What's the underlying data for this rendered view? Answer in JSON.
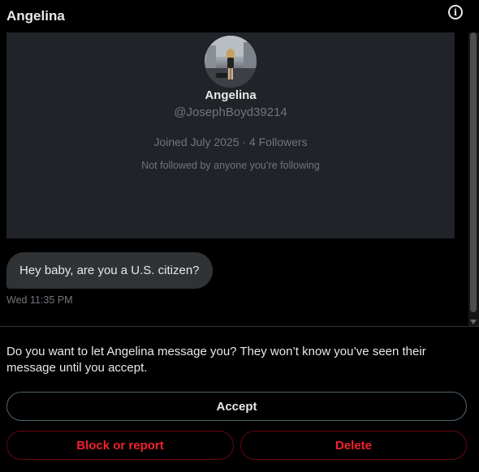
{
  "header": {
    "title": "Angelina",
    "info_icon": "info-icon"
  },
  "profile": {
    "name": "Angelina",
    "handle": "@JosephBoyd39214",
    "joined": "Joined July 2025 · 4 Followers",
    "followed_note": "Not followed by anyone you’re following"
  },
  "conversation": {
    "messages": [
      {
        "text": "Hey baby, are you a U.S. citizen?",
        "timestamp": "Wed 11:35 PM"
      }
    ]
  },
  "request": {
    "prompt": "Do you want to let Angelina message you? They won’t know you’ve seen their message until you accept.",
    "accept_label": "Accept",
    "block_label": "Block or report",
    "delete_label": "Delete"
  },
  "colors": {
    "background": "#000000",
    "card": "#202327",
    "bubble": "#2f3336",
    "muted_text": "#71767b",
    "danger": "#f4212e"
  }
}
